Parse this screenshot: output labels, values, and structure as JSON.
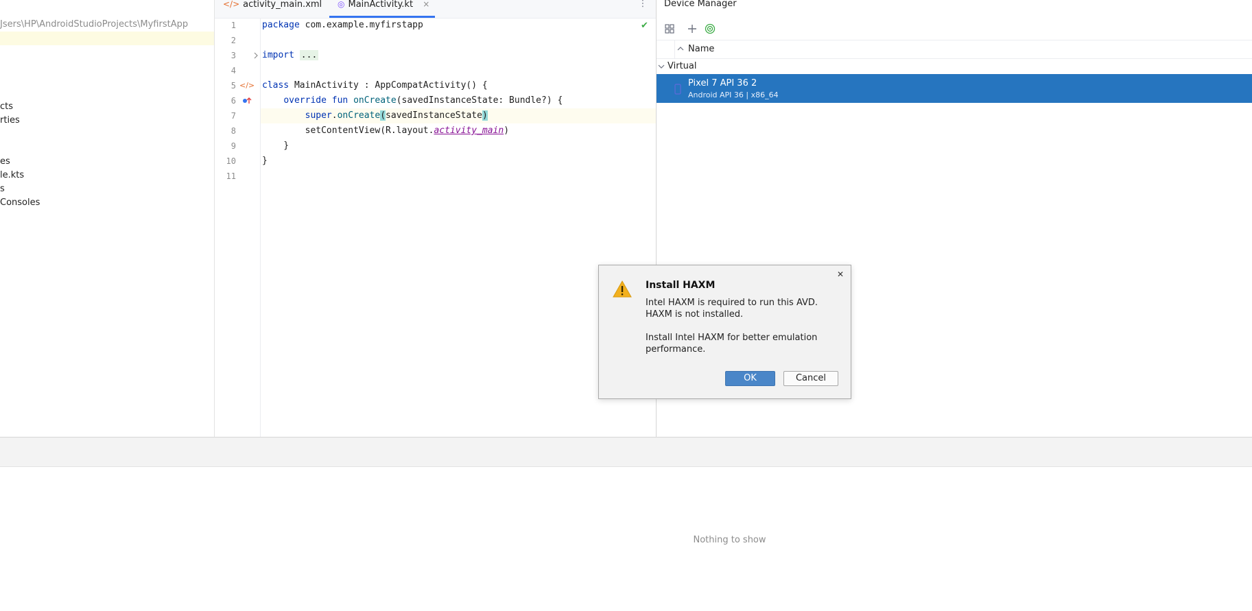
{
  "project": {
    "path": "Jsers\\HP\\AndroidStudioProjects\\MyfirstApp",
    "items": [
      "cts",
      "rties",
      "es",
      "le.kts",
      "s",
      "Consoles"
    ]
  },
  "tabs": [
    {
      "label": "activity_main.xml",
      "icon": "xml-tag-icon"
    },
    {
      "label": "MainActivity.kt",
      "icon": "kotlin-class-icon",
      "close": "×"
    }
  ],
  "tab_menu_icon": "⋮",
  "editor": {
    "line_numbers": [
      "1",
      "2",
      "3",
      "4",
      "5",
      "6",
      "7",
      "8",
      "9",
      "10",
      "11"
    ],
    "lines": {
      "l1_kw": "package",
      "l1_rest": " com.example.myfirstapp",
      "l3_kw": "import",
      "l3_fold": "...",
      "l6_kw": "class",
      "l6_rest": " MainActivity : AppCompatActivity() {",
      "l7_indent": "    ",
      "l7_kw": "override fun",
      "l7_fn": "onCreate",
      "l7_rest": "(savedInstanceState: Bundle?) {",
      "l8_indent": "        ",
      "l8_kw": "super",
      "l8_dot": ".",
      "l8_fn": "onCreate",
      "l8_open": "(",
      "l8_arg": "savedInstanceState",
      "l8_close": ")",
      "l9_indent": "        ",
      "l9_call": "setContentView(R.layout.",
      "l9_prop": "activity_main",
      "l9_close": ")",
      "l10": "    }",
      "l11": "}"
    },
    "check_icon": "✔"
  },
  "device_manager": {
    "title": "Device Manager",
    "column_name": "Name",
    "group": "Virtual",
    "device_name": "Pixel 7 API 36 2",
    "device_detail": "Android API 36 | x86_64"
  },
  "bottom_panel": {
    "empty_text": "Nothing to show"
  },
  "dialog": {
    "title": "Install HAXM",
    "line1": "Intel HAXM is required to run this AVD.",
    "line2": "HAXM is not installed.",
    "line3": "Install Intel HAXM for better emulation",
    "line4": "performance.",
    "ok_label": "OK",
    "cancel_label": "Cancel",
    "close_icon": "✕"
  },
  "colors": {
    "selection": "#2675bf",
    "accent_tab": "#3574f0",
    "ok_button": "#4a86c8",
    "warning": "#f2b01e"
  }
}
